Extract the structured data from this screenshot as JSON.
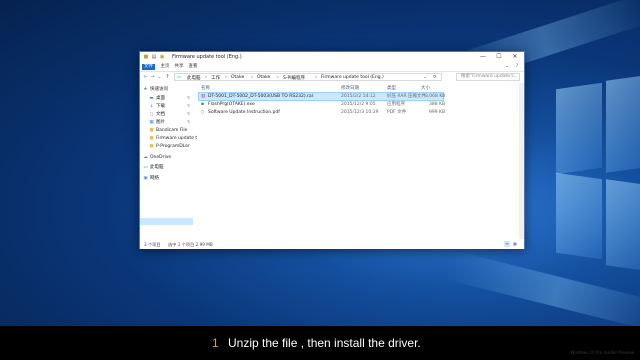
{
  "window": {
    "title": "Firmware update tool (Eng.)",
    "ribbon_tabs": [
      "文件",
      "主页",
      "共享",
      "查看"
    ],
    "breadcrumbs": [
      "此电脑",
      "工作",
      "Otake",
      "Otake",
      "S-PI编程序",
      "Firmware update tool (Eng.)"
    ],
    "search_placeholder": "搜索\"Firmware update t...",
    "buttons": {
      "minimize": "—",
      "maximize": "☐",
      "close": "✕",
      "back": "←",
      "forward": "→",
      "up": "↑",
      "recent": "⌄",
      "refresh": "⟳",
      "help": "?"
    }
  },
  "nav": {
    "items": [
      {
        "label": "快速访问",
        "icon": "star-icon",
        "pinned": false
      },
      {
        "label": "桌面",
        "icon": "desktop-icon",
        "pinned": true
      },
      {
        "label": "下载",
        "icon": "download-icon",
        "pinned": true
      },
      {
        "label": "文档",
        "icon": "document-icon",
        "pinned": true
      },
      {
        "label": "图片",
        "icon": "picture-icon",
        "pinned": true
      },
      {
        "label": "Bandicam File",
        "icon": "folder-icon",
        "pinned": false
      },
      {
        "label": "Firmware update t",
        "icon": "folder-icon",
        "pinned": false
      },
      {
        "label": "P-ProgramDLer",
        "icon": "folder-icon",
        "pinned": false
      },
      {
        "label": "OneDrive",
        "icon": "cloud-icon",
        "pinned": false
      },
      {
        "label": "此电脑",
        "icon": "computer-icon",
        "pinned": false
      },
      {
        "label": "网络",
        "icon": "network-icon",
        "pinned": false
      }
    ]
  },
  "files": {
    "columns": [
      "名称",
      "修改日期",
      "类型",
      "大小"
    ],
    "rows": [
      {
        "name": "DT-5001_DT-5002_DT-5003(USB TO RS232).rar",
        "date": "2015/2/2 14:12",
        "type": "好压 RAR 压缩文件",
        "size": "3,068 KB",
        "icon": "rar-archive-icon",
        "selected": true
      },
      {
        "name": "FlashPrg(OTAKE).exe",
        "date": "2015/12/2 9:05",
        "type": "应用程序",
        "size": "388 KB",
        "icon": "application-icon",
        "selected": false
      },
      {
        "name": "Software Update Instruction.pdf",
        "date": "2015/12/3 10:29",
        "type": "PDF 文件",
        "size": "999 KB",
        "icon": "pdf-icon",
        "selected": false
      }
    ]
  },
  "status": {
    "count": "3 个项目",
    "selection": "选中 1 个项目  2.99 MB"
  },
  "subtitle": {
    "number": "1",
    "text": "Unzip the file , then install the driver."
  },
  "watermark": "Windows 10 Pro Insider Preview"
}
